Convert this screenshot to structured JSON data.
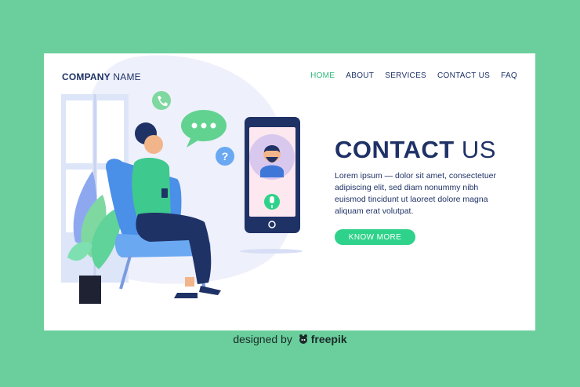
{
  "header": {
    "brand_bold": "COMPANY",
    "brand_light": " NAME",
    "nav": [
      "HOME",
      "ABOUT",
      "SERVICES",
      "CONTACT US",
      "FAQ"
    ],
    "active_nav": "HOME"
  },
  "hero": {
    "title_bold": "CONTACT",
    "title_light": " US",
    "body": "Lorem ipsum — dolor sit amet, consectetuer adipiscing elit, sed diam nonummy nibh euismod tincidunt ut laoreet dolore magna aliquam erat volutpat.",
    "cta_label": "KNOW MORE"
  },
  "icons": [
    "phone-icon",
    "chat-bubble-icon",
    "question-icon",
    "microphone-icon",
    "freepik-logo-icon"
  ],
  "footer": {
    "credit_prefix": "designed by",
    "credit_brand": "freepik"
  },
  "colors": {
    "background": "#6acf9c",
    "navy": "#1f3266",
    "accent": "#2fd28a"
  }
}
